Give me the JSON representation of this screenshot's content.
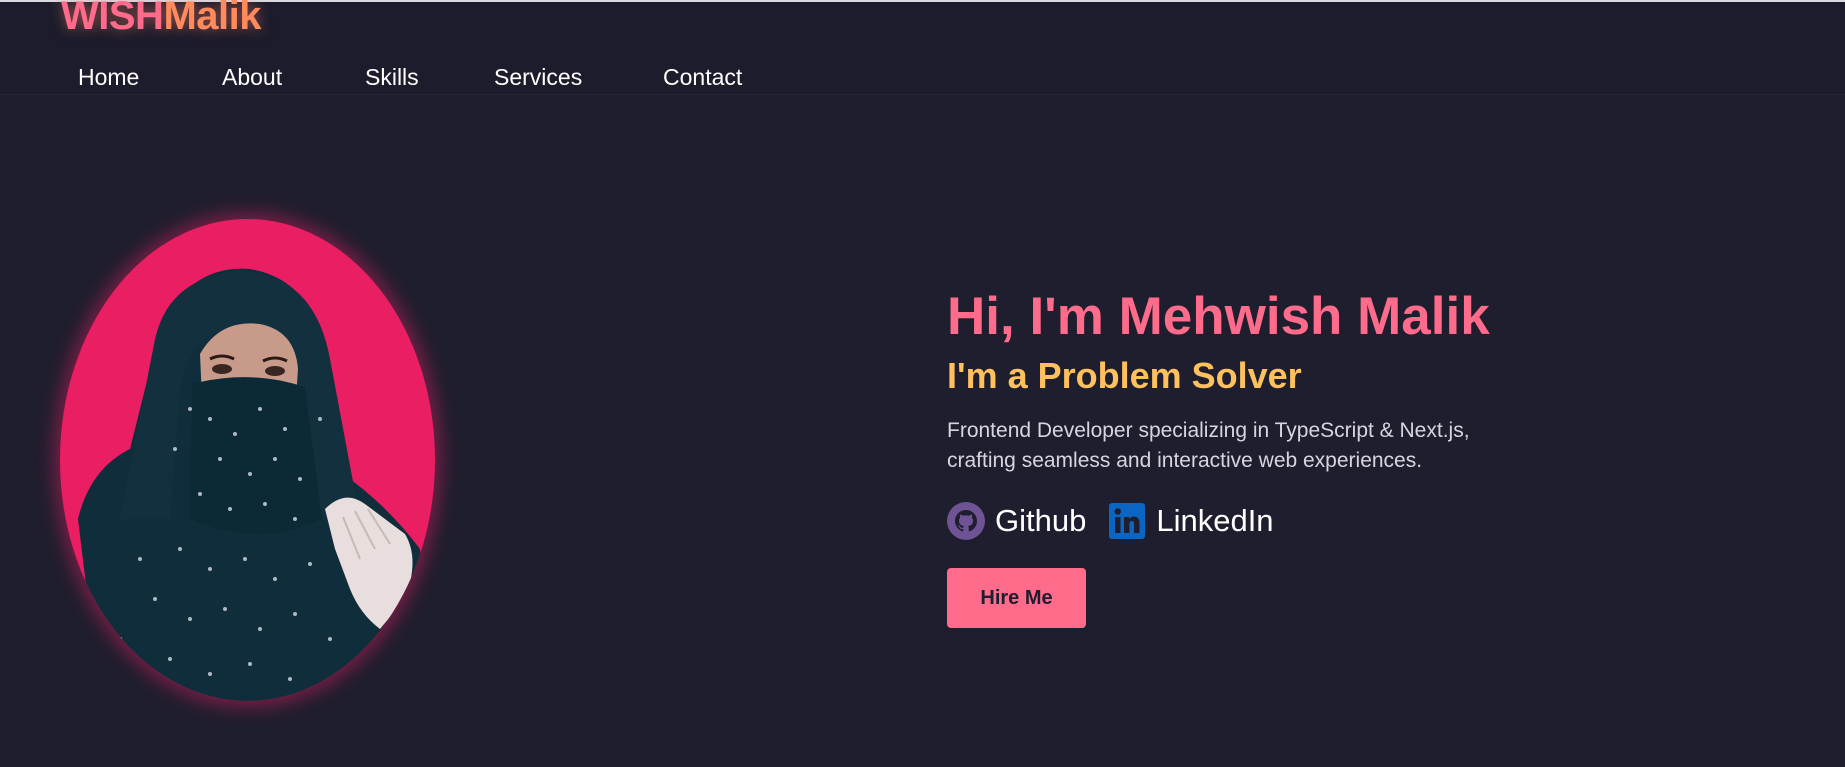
{
  "logo": {
    "part1": "WISH",
    "part2": "Malik"
  },
  "nav": {
    "home": "Home",
    "about": "About",
    "skills": "Skills",
    "services": "Services",
    "contact": "Contact"
  },
  "hero": {
    "title": "Hi, I'm Mehwish Malik",
    "subtitle": "I'm a Problem Solver",
    "description": "Frontend Developer specializing in TypeScript & Next.js, crafting seamless and interactive web experiences.",
    "github_label": "Github",
    "linkedin_label": "LinkedIn",
    "hire_label": "Hire Me"
  },
  "icons": {
    "github": "github-icon",
    "linkedin": "linkedin-icon"
  },
  "colors": {
    "background": "#1f1e2e",
    "accent_pink": "#ff6b8b",
    "accent_orange": "#ff8a5c",
    "accent_yellow": "#ffc15e",
    "portrait_bg": "#e91e63",
    "linkedin_blue": "#0a66c2",
    "github_purple": "#6e5494"
  }
}
